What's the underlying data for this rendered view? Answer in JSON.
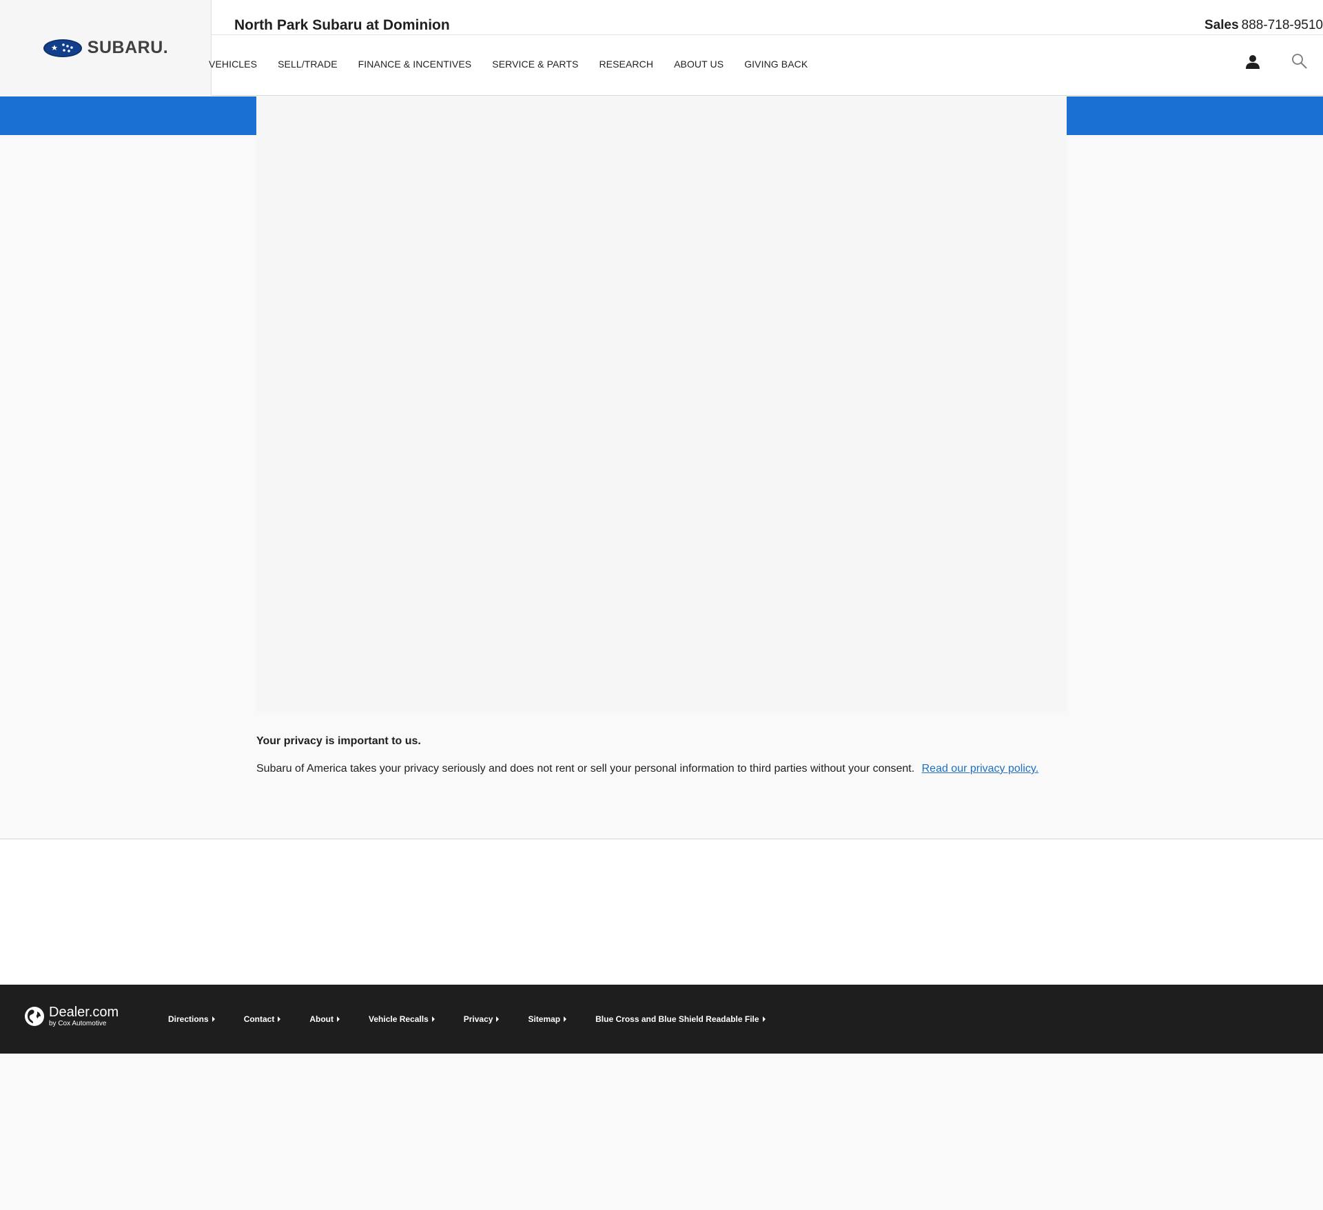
{
  "header": {
    "logo_text": "SUBARU.",
    "dealer_name": "North Park Subaru at Dominion",
    "phone_label": "Sales",
    "phone_number": "888-718-9510",
    "nav": [
      {
        "label": "VEHICLES"
      },
      {
        "label": "SELL/TRADE"
      },
      {
        "label": "FINANCE & INCENTIVES"
      },
      {
        "label": "SERVICE & PARTS"
      },
      {
        "label": "RESEARCH"
      },
      {
        "label": "ABOUT US"
      },
      {
        "label": "GIVING BACK"
      }
    ]
  },
  "colors": {
    "accent_blue": "#1a70d3",
    "link_blue": "#1f6fbf",
    "footer_bg": "#1e1e1e"
  },
  "privacy": {
    "heading": "Your privacy is important to us.",
    "text": "Subaru of America takes your privacy seriously and does not rent or sell your personal information to third parties without your consent.",
    "link": "Read our privacy policy."
  },
  "footer": {
    "brand_name": "Dealer.com",
    "brand_sub": "by Cox Automotive",
    "links": [
      {
        "label": "Directions"
      },
      {
        "label": "Contact"
      },
      {
        "label": "About"
      },
      {
        "label": "Vehicle Recalls"
      },
      {
        "label": "Privacy"
      },
      {
        "label": "Sitemap"
      },
      {
        "label": "Blue Cross and Blue Shield Readable File"
      }
    ]
  },
  "icons": {
    "brand": "subaru-emblem-icon",
    "account": "user-icon",
    "search": "search-icon",
    "footer_brand": "globe-icon",
    "link_arrow": "caret-right-icon"
  }
}
